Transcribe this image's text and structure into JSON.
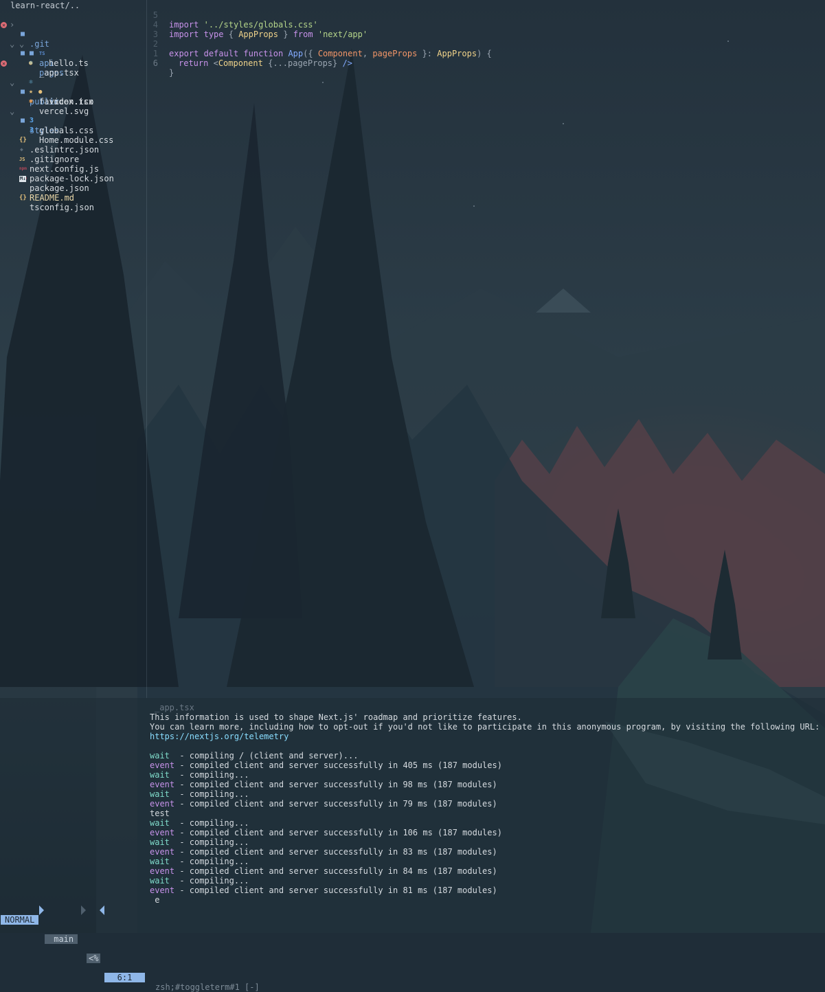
{
  "tree": {
    "root": "learn-react/..",
    "items": [
      {
        "name": ".git",
        "type": "dir",
        "open": false
      },
      {
        "name": "pages",
        "type": "dir",
        "open": true
      },
      {
        "name": "api",
        "type": "dir",
        "open": true
      },
      {
        "name": "hello.ts",
        "type": "file",
        "icon_text": "TS"
      },
      {
        "name": "_app.tsx",
        "type": "file",
        "icon_text": "⚛"
      },
      {
        "name": "index.tsx",
        "type": "file",
        "icon_text": "⚛"
      },
      {
        "name": "public",
        "type": "dir",
        "open": true
      },
      {
        "name": "favicon.ico",
        "type": "file",
        "icon_text": "★"
      },
      {
        "name": "vercel.svg",
        "type": "file",
        "icon_text": "✱"
      },
      {
        "name": "styles",
        "type": "dir",
        "open": true
      },
      {
        "name": "globals.css",
        "type": "file",
        "icon_text": "3"
      },
      {
        "name": "Home.module.css",
        "type": "file",
        "icon_text": "3"
      },
      {
        "name": ".eslintrc.json",
        "type": "file",
        "icon_text": "{}"
      },
      {
        "name": ".gitignore",
        "type": "file",
        "icon_text": "◆"
      },
      {
        "name": "next.config.js",
        "type": "file",
        "icon_text": "JS"
      },
      {
        "name": "package-lock.json",
        "type": "file",
        "icon_text": "npm"
      },
      {
        "name": "package.json",
        "type": "file",
        "icon_text": "npm"
      },
      {
        "name": "README.md",
        "type": "file",
        "icon_text": "M↓"
      },
      {
        "name": "tsconfig.json",
        "type": "file",
        "icon_text": "{}"
      }
    ],
    "git_dot": "●",
    "error_mark": "✕",
    "chevron_open": "⌄",
    "chevron_closed": "›"
  },
  "editor": {
    "line_numbers": [
      "5",
      "4",
      "3",
      "2",
      "1",
      "6"
    ],
    "code": {
      "l1": {
        "kw": "import",
        "str": "'../styles/globals.css'"
      },
      "l2": {
        "kw": "import",
        "kw_type": "type",
        "brace_open": "{",
        "type": "AppProps",
        "brace_close": "}",
        "from": "from",
        "str": "'next/app'"
      },
      "l4": {
        "kw_export": "export",
        "kw_default": "default",
        "kw_function": "function",
        "fn": "App",
        "p_open": "({",
        "param1": "Component",
        "comma": ",",
        "param2": "pageProps",
        "p_mid": "}:",
        "type": "AppProps",
        "p_close": ") {"
      },
      "l5": {
        "kw_return": "return",
        "lt": "<",
        "tag": "Component",
        "spread": "{...pageProps}",
        "close": "/>"
      },
      "l6": "}"
    },
    "tilde": "~"
  },
  "terminal": {
    "file_label": "_app.tsx",
    "info1": "This information is used to shape Next.js' roadmap and prioritize features.",
    "info2": "You can learn more, including how to opt-out if you'd not like to participate in this anonymous program, by visiting the following URL:",
    "url": "https://nextjs.org/telemetry",
    "lines": [
      {
        "tag": "wait",
        "text": "  - compiling / (client and server)..."
      },
      {
        "tag": "event",
        "text": " - compiled client and server successfully in 405 ms (187 modules)"
      },
      {
        "tag": "wait",
        "text": "  - compiling..."
      },
      {
        "tag": "event",
        "text": " - compiled client and server successfully in 98 ms (187 modules)"
      },
      {
        "tag": "wait",
        "text": "  - compiling..."
      },
      {
        "tag": "event",
        "text": " - compiled client and server successfully in 79 ms (187 modules)"
      },
      {
        "tag": "",
        "text": "test"
      },
      {
        "tag": "wait",
        "text": "  - compiling..."
      },
      {
        "tag": "event",
        "text": " - compiled client and server successfully in 106 ms (187 modules)"
      },
      {
        "tag": "wait",
        "text": "  - compiling..."
      },
      {
        "tag": "event",
        "text": " - compiled client and server successfully in 83 ms (187 modules)"
      },
      {
        "tag": "wait",
        "text": "  - compiling..."
      },
      {
        "tag": "event",
        "text": " - compiled client and server successfully in 84 ms (187 modules)"
      },
      {
        "tag": "wait",
        "text": "  - compiling..."
      },
      {
        "tag": "event",
        "text": " - compiled client and server successfully in 81 ms (187 modules)"
      }
    ],
    "prompt_line": " e"
  },
  "statusline": {
    "mode": "NORMAL",
    "branch": " main",
    "symbol": "<%",
    "position": "6:1",
    "terminal_name": "zsh;#toggleterm#1 [-]"
  },
  "colors": {
    "mode_bg": "#8fb7e8",
    "wait": "#7fdbca",
    "event": "#c792ea",
    "link": "#89ddff"
  }
}
